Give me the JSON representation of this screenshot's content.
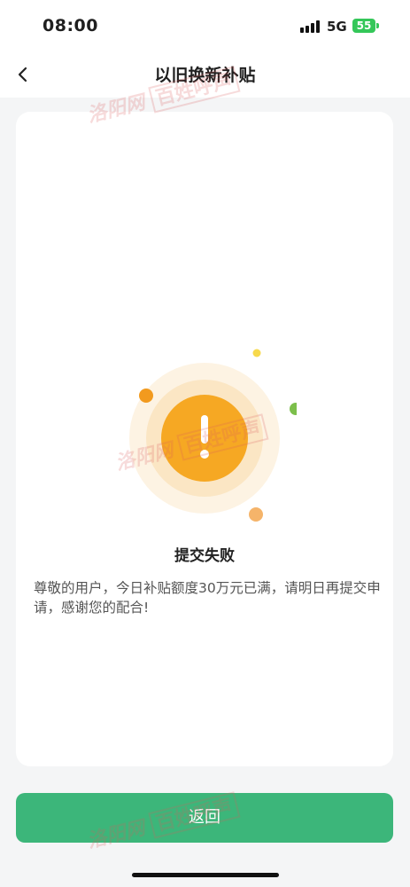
{
  "status_bar": {
    "time": "08:00",
    "network": "5G",
    "battery": "55"
  },
  "navbar": {
    "title": "以旧换新补贴",
    "back_icon": "chevron-left-icon"
  },
  "result": {
    "icon": "exclamation-warning-icon",
    "title": "提交失败",
    "message": "尊敬的用户，今日补贴额度30万元已满，请明日再提交申请，感谢您的配合!"
  },
  "footer": {
    "return_label": "返回"
  },
  "watermark": {
    "site": "洛阳网",
    "column": "百姓呼声"
  },
  "colors": {
    "accent_green": "#3cb67a",
    "warning_orange": "#f5a623",
    "battery_green": "#34c759"
  }
}
